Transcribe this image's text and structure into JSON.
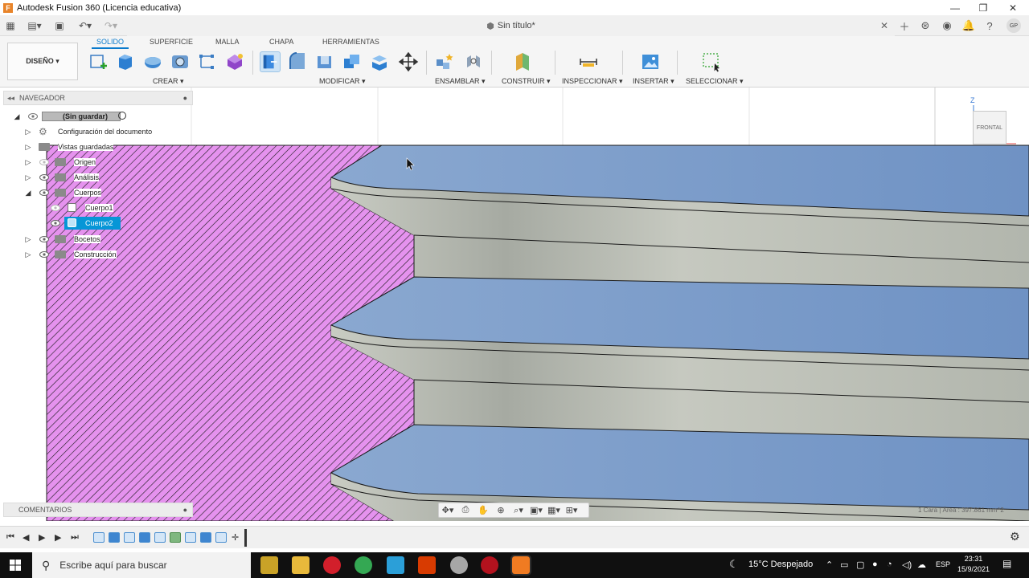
{
  "window": {
    "title": "Autodesk Fusion 360 (Licencia educativa)",
    "minimize": "—",
    "maximize": "❐",
    "close": "✕"
  },
  "tabbar": {
    "document_title": "Sin título*",
    "avatar": "GP"
  },
  "ribbon": {
    "workspace": "DISEÑO ▾",
    "tabs": [
      "SOLIDO",
      "SUPERFICIE",
      "MALLA",
      "CHAPA",
      "HERRAMIENTAS"
    ],
    "groups": [
      "CREAR ▾",
      "MODIFICAR ▾",
      "ENSAMBLAR ▾",
      "CONSTRUIR ▾",
      "INSPECCIONAR ▾",
      "INSERTAR ▾",
      "SELECCIONAR ▾"
    ]
  },
  "browser": {
    "header": "NAVEGADOR",
    "root": "(Sin guardar)",
    "items": [
      {
        "label": "Configuración del documento"
      },
      {
        "label": "Vistas guardadas"
      },
      {
        "label": "Origen"
      },
      {
        "label": "Análisis"
      },
      {
        "label": "Cuerpos"
      },
      {
        "label": "Cuerpo1"
      },
      {
        "label": "Cuerpo2",
        "selected": true
      },
      {
        "label": "Bocetos"
      },
      {
        "label": "Construcción"
      }
    ],
    "comments": "COMENTARIOS"
  },
  "viewcube": {
    "face": "FRONTAL",
    "axis": "Z"
  },
  "status": {
    "selection_info": "1 Cara | Área : 397.861 mm^2"
  },
  "taskbar": {
    "search_placeholder": "Escribe aquí para buscar",
    "weather": "15°C  Despejado",
    "language": "ESP",
    "time": "23:31",
    "date": "15/9/2021"
  },
  "colors": {
    "accent": "#0a7acc",
    "face_blue": "#7b9cc8",
    "body_gray": "#b4b8b0",
    "hatch_pink": "#e592ee"
  }
}
